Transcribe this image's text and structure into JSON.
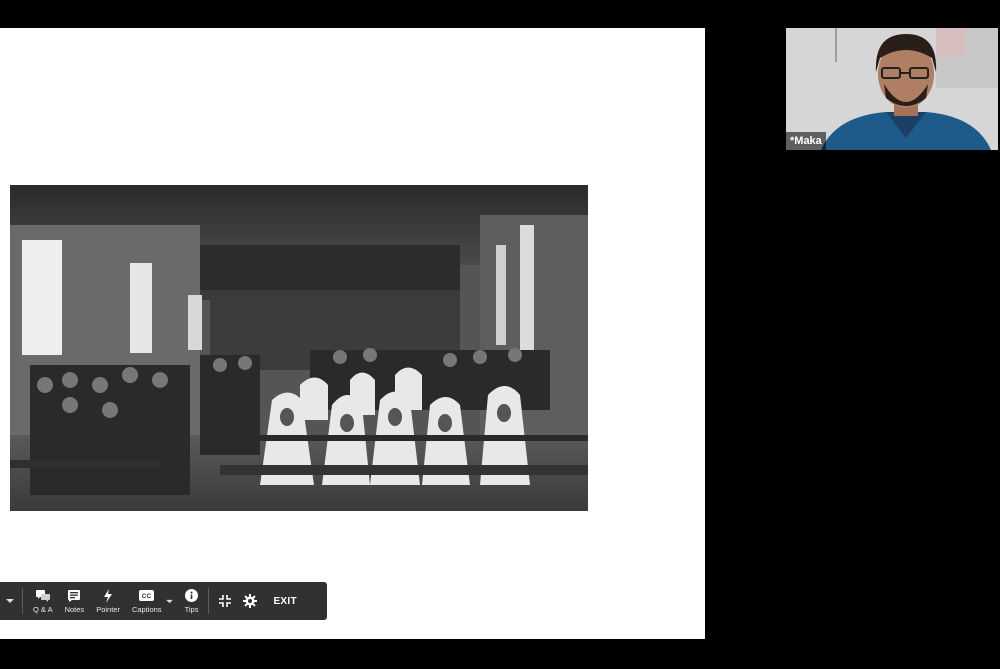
{
  "presenter": {
    "name": "*Maka"
  },
  "toolbar": {
    "qa_label": "Q & A",
    "notes_label": "Notes",
    "pointer_label": "Pointer",
    "captions_label": "Captions",
    "tips_label": "Tips",
    "exit_label": "EXIT"
  },
  "icons": {
    "more": "chevron-down-icon",
    "qa": "chat-bubbles-icon",
    "notes": "notes-icon",
    "pointer": "laser-pointer-icon",
    "captions": "cc-icon",
    "tips": "info-icon",
    "exit_fullscreen": "exit-fullscreen-icon",
    "settings": "gear-icon"
  },
  "colors": {
    "background": "#000000",
    "slide": "#ffffff",
    "toolbar": "#2f3133"
  }
}
